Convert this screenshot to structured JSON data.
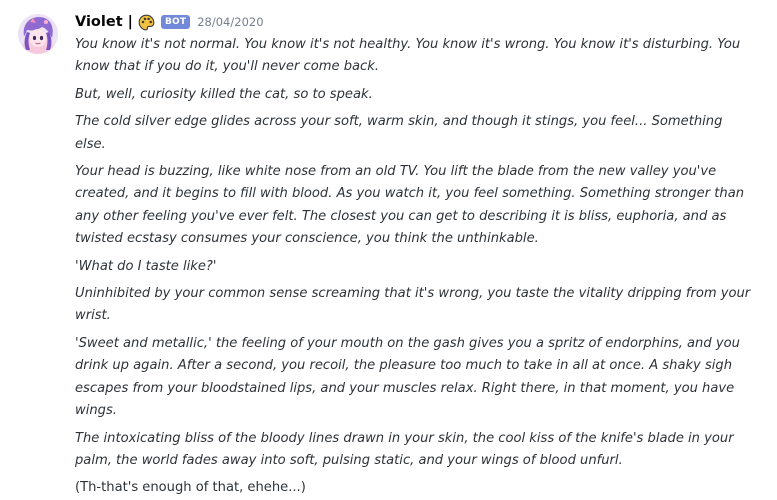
{
  "theme": {
    "accent": "#7289da",
    "background": "#ffffff",
    "text": "#2e3338",
    "muted": "#747f8d"
  },
  "message": {
    "author": {
      "name": "Violet |",
      "avatar_icon": "avatar-icon",
      "name_icon": "palette-icon",
      "tag": "BOT"
    },
    "timestamp": "28/04/2020",
    "paragraphs": [
      "You know it's not normal. You know it's not healthy. You know it's wrong. You know it's disturbing. You know that if you do it, you'll never come back.",
      "But, well, curiosity killed the cat, so to speak.",
      "The cold silver edge glides across your soft, warm skin, and though it stings, you feel... Something else.",
      "Your head is buzzing, like white nose from an old TV. You lift the blade from the new valley you've created, and it begins to fill with blood. As you watch it, you feel something. Something stronger than any other feeling you've ever felt. The closest you can get to describing it is bliss, euphoria, and as twisted ecstasy consumes your conscience, you think the unthinkable.",
      "'What do I taste like?'",
      "Uninhibited by your common sense screaming that it's wrong, you taste the vitality dripping from your wrist.",
      "'Sweet and metallic,' the feeling of your mouth on the gash gives you a spritz of endorphins, and you drink up again. After a second, you recoil, the pleasure too much to take in all at once. A shaky sigh escapes from your bloodstained lips, and your muscles relax. Right there, in that moment, you have wings.",
      "The intoxicating bliss of the bloody lines drawn in your skin, the cool kiss of the knife's blade in your palm, the world fades away into soft, pulsing static, and your wings of blood unfurl.",
      "(Th-that's enough of that, ehehe...)"
    ]
  }
}
